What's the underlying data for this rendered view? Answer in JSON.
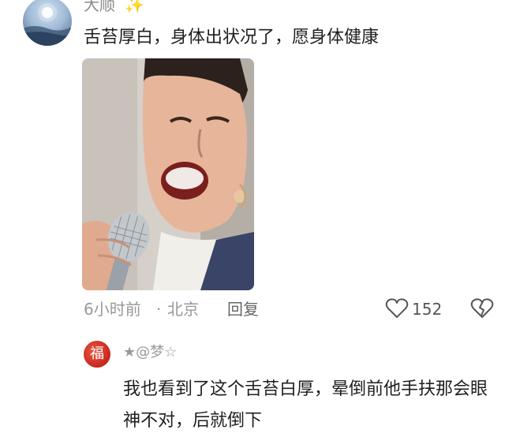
{
  "comment": {
    "username": "大顺",
    "username_emoji": "✨",
    "text": "舌苔厚白，身体出状况了，愿身体健康",
    "time": "6小时前",
    "separator": "·",
    "location": "北京",
    "reply_label": "回复",
    "like_count": "152",
    "image_icon": "person-with-microphone-photo"
  },
  "reply": {
    "avatar_char": "福",
    "username": "★@梦☆",
    "text": "我也看到了这个舌苔白厚，晕倒前他手扶那会眼神不对，后就倒下"
  },
  "icons": {
    "like": "heart-outline-icon",
    "dislike": "broken-heart-icon"
  },
  "colors": {
    "meta_text": "#999999",
    "body_text": "#1f1f1f",
    "reply_avatar": "#c7261c"
  }
}
